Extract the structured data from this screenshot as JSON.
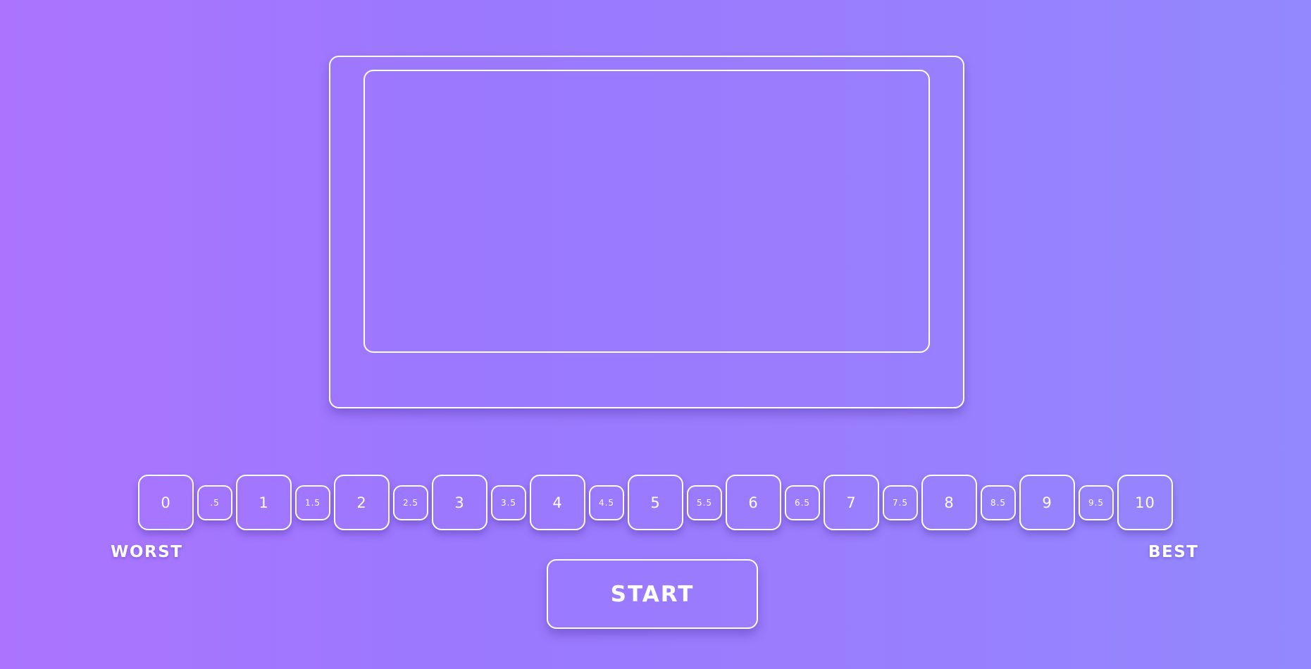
{
  "scale": {
    "worst_label": "WORST",
    "best_label": "BEST",
    "buttons": [
      {
        "label": "0",
        "size": "major"
      },
      {
        "label": ".5",
        "size": "minor"
      },
      {
        "label": "1",
        "size": "major"
      },
      {
        "label": "1.5",
        "size": "minor"
      },
      {
        "label": "2",
        "size": "major"
      },
      {
        "label": "2.5",
        "size": "minor"
      },
      {
        "label": "3",
        "size": "major"
      },
      {
        "label": "3.5",
        "size": "minor"
      },
      {
        "label": "4",
        "size": "major"
      },
      {
        "label": "4.5",
        "size": "minor"
      },
      {
        "label": "5",
        "size": "major"
      },
      {
        "label": "5.5",
        "size": "minor"
      },
      {
        "label": "6",
        "size": "major"
      },
      {
        "label": "6.5",
        "size": "minor"
      },
      {
        "label": "7",
        "size": "major"
      },
      {
        "label": "7.5",
        "size": "minor"
      },
      {
        "label": "8",
        "size": "major"
      },
      {
        "label": "8.5",
        "size": "minor"
      },
      {
        "label": "9",
        "size": "major"
      },
      {
        "label": "9.5",
        "size": "minor"
      },
      {
        "label": "10",
        "size": "major"
      }
    ]
  },
  "start_button": {
    "label": "START"
  },
  "colors": {
    "background_start": "#ac74fe",
    "background_end": "#9388fd",
    "outline": "#ffffff"
  }
}
